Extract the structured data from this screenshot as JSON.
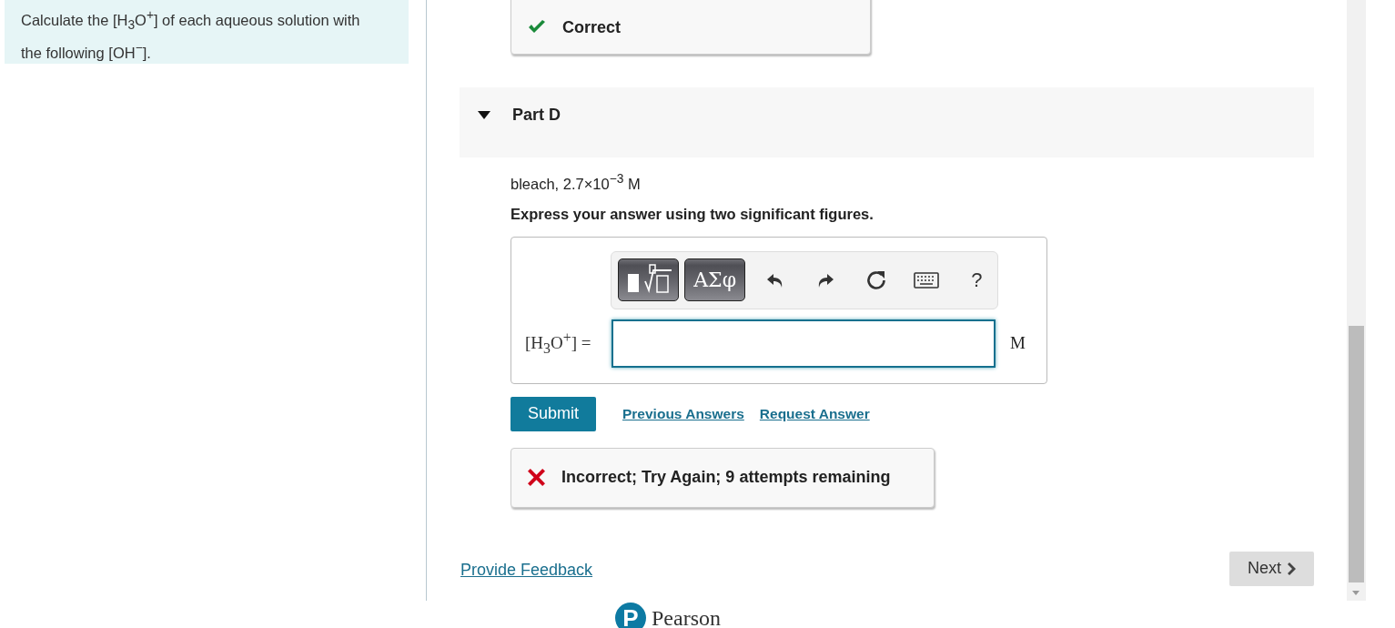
{
  "intro": "Calculate the [H$_{3}$O$^{+}$] of each aqueous solution with the following [OH$^{−}$].",
  "feedback_top": {
    "kind": "correct",
    "text": "Correct"
  },
  "part": {
    "title": "Part D",
    "expanded": true
  },
  "prompt": "bleach, 2.7×10$^{−3}$ M",
  "instruction": "Express your answer using two significant figures.",
  "answer": {
    "label": "[H$_{3}$O$^{+}$] =",
    "unit": "M"
  },
  "toolbar": [
    {
      "kind": "templates"
    },
    {
      "kind": "symbols",
      "label": "ΑΣφ"
    },
    {
      "kind": "undo"
    },
    {
      "kind": "redo"
    },
    {
      "kind": "reset"
    },
    {
      "kind": "keyboard"
    },
    {
      "kind": "help",
      "label": "?"
    }
  ],
  "submit": "Submit",
  "links": [
    "Previous Answers",
    "Request Answer"
  ],
  "feedback": {
    "kind": "incorrect",
    "text": "Incorrect; Try Again; 9 attempts remaining"
  },
  "footer_link": "Provide Feedback",
  "next": "Next",
  "logo": {
    "mark": "P",
    "name": "Pearson"
  }
}
